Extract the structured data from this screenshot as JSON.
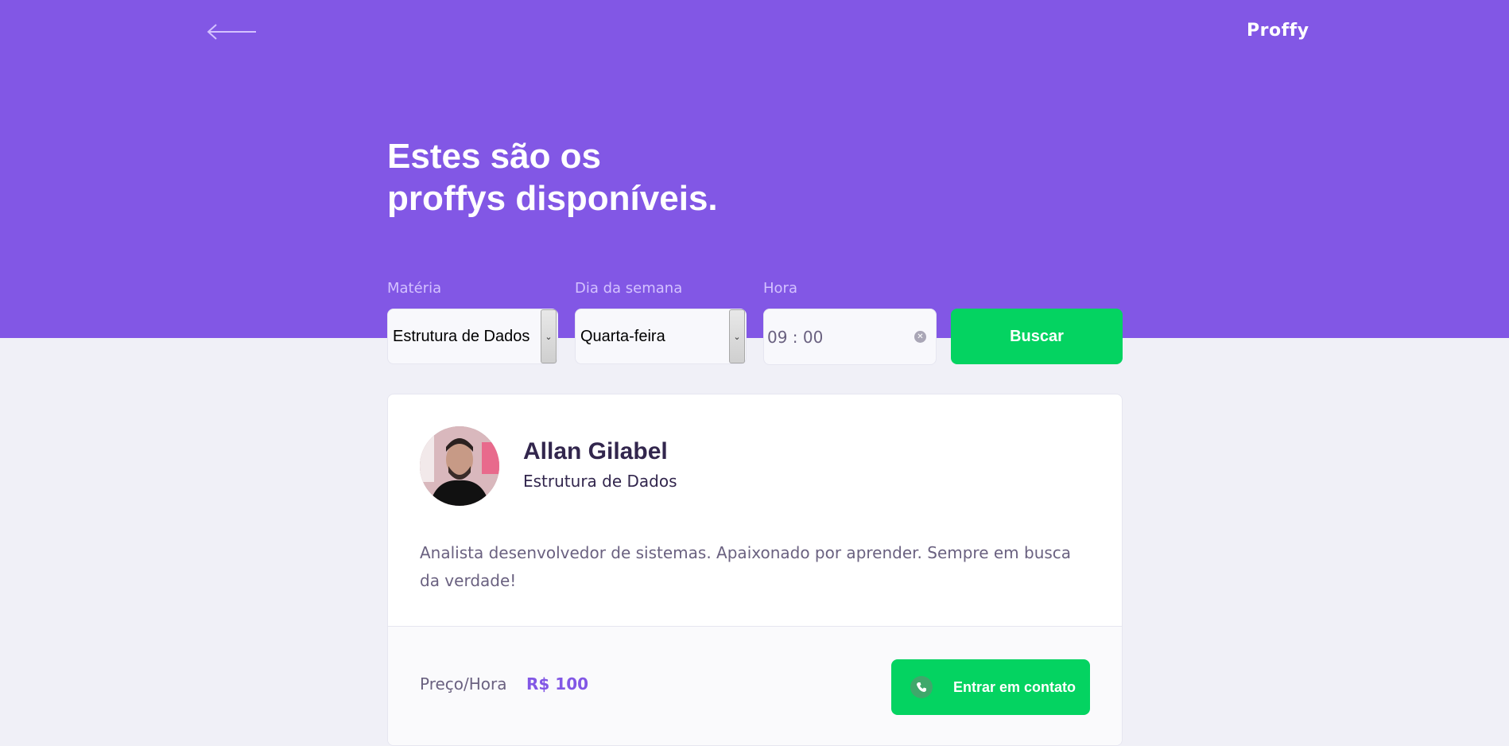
{
  "header": {
    "logo": "Proffy",
    "back_icon": "arrow-left-icon",
    "title_line1": "Estes são os",
    "title_line2": "proffys disponíveis."
  },
  "filters": {
    "subject_label": "Matéria",
    "subject_value": "Estrutura de Dados",
    "weekday_label": "Dia da semana",
    "weekday_value": "Quarta-feira",
    "time_label": "Hora",
    "time_value": "09 : 00",
    "search_label": "Buscar"
  },
  "teacher": {
    "name": "Allan Gilabel",
    "subject": "Estrutura de Dados",
    "bio": "Analista desenvolvedor de sistemas. Apaixonado por aprender. Sempre em busca da verdade!",
    "price_label": "Preço/Hora",
    "price_value": "R$ 100",
    "contact_label": "Entrar em contato",
    "contact_icon": "whatsapp-icon"
  },
  "colors": {
    "primary": "#8257e5",
    "secondary": "#04d361",
    "background": "#f0f0f7",
    "title_dark": "#32264d",
    "text_muted": "#6a6180"
  }
}
